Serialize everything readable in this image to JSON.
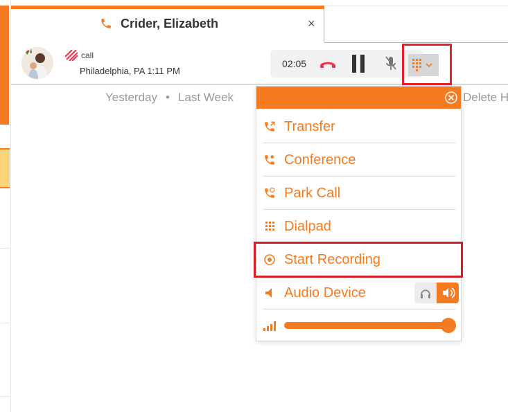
{
  "tab": {
    "title": "Crider, Elizabeth",
    "close_glyph": "×",
    "icon": "phone-icon"
  },
  "call": {
    "type_label": "call",
    "location_time": "Philadelphia, PA 1:11 PM",
    "timer": "02:05",
    "icons": [
      "hangup-icon",
      "pause-icon",
      "mic-muted-icon",
      "dialpad-icon",
      "chevron-down-icon"
    ]
  },
  "filters": {
    "yesterday": "Yesterday",
    "separator": "•",
    "last_week": "Last Week",
    "delete_partial": "Delete H"
  },
  "menu": {
    "close_icon": "close-circle-icon",
    "items": [
      {
        "label": "Transfer",
        "icon": "transfer-icon"
      },
      {
        "label": "Conference",
        "icon": "conference-icon"
      },
      {
        "label": "Park Call",
        "icon": "park-call-icon"
      },
      {
        "label": "Dialpad",
        "icon": "dialpad-icon"
      },
      {
        "label": "Start Recording",
        "icon": "record-icon"
      },
      {
        "label": "Audio Device",
        "icon": "speaker-icon"
      }
    ],
    "audio_device_options": [
      "headset-icon",
      "speaker-icon"
    ],
    "audio_device_selected": "speaker-icon",
    "volume_level": 1.0
  },
  "colors": {
    "accent": "#f47b20",
    "highlight": "#e4212a",
    "hangup": "#e8334a"
  }
}
